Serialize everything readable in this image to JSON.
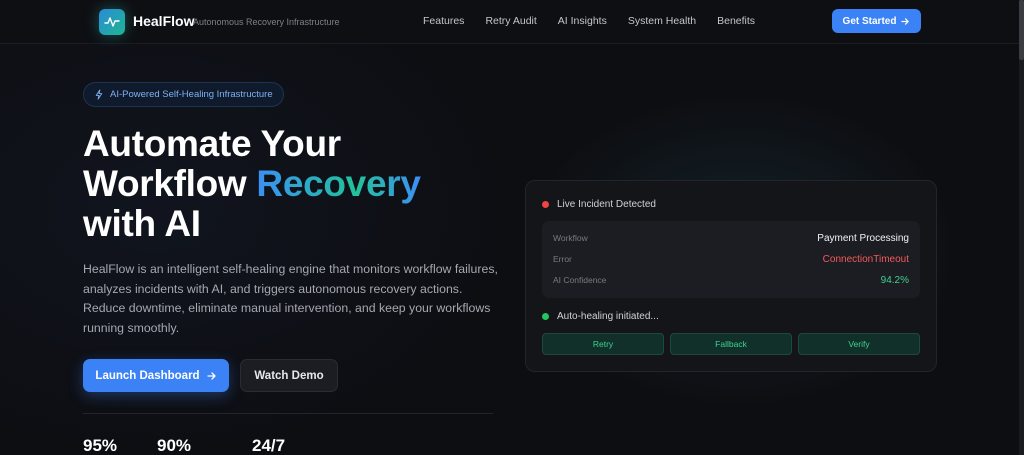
{
  "nav": {
    "brand": "HealFlow",
    "tagline": "Autonomous Recovery Infrastructure",
    "links": [
      "Features",
      "Retry Audit",
      "AI Insights",
      "System Health",
      "Benefits"
    ],
    "cta_label": "Get Started"
  },
  "hero": {
    "pill_label": "AI-Powered Self-Healing Infrastructure",
    "headline_line1": "Automate Your",
    "headline_line2_plain": "Workflow ",
    "headline_line2_accent": "Recovery",
    "headline_line3": "with AI",
    "description": "HealFlow is an intelligent self-healing engine that monitors workflow failures, analyzes incidents with AI, and triggers autonomous recovery actions. Reduce downtime, eliminate manual intervention, and keep your workflows running smoothly.",
    "primary_button": "Launch Dashboard",
    "secondary_button": "Watch Demo",
    "stats": [
      "95%",
      "90%",
      "24/7"
    ]
  },
  "incident_card": {
    "status_title": "Live Incident Detected",
    "rows": [
      {
        "label": "Workflow",
        "value": "Payment Processing"
      },
      {
        "label": "Error",
        "value": "ConnectionTimeout"
      },
      {
        "label": "AI Confidence",
        "value": "94.2%"
      }
    ],
    "healing_status": "Auto-healing initiated...",
    "actions": [
      "Retry",
      "Fallback",
      "Verify"
    ]
  },
  "colors": {
    "accent_blue": "#3b82f6",
    "accent_green": "#22c29a",
    "error_red": "#ef4444",
    "success_green": "#3ed192",
    "background": "#0d0e12"
  },
  "icons": {
    "logo": "pulse-icon",
    "pill": "lightning-icon",
    "arrow": "arrow-right-icon"
  }
}
